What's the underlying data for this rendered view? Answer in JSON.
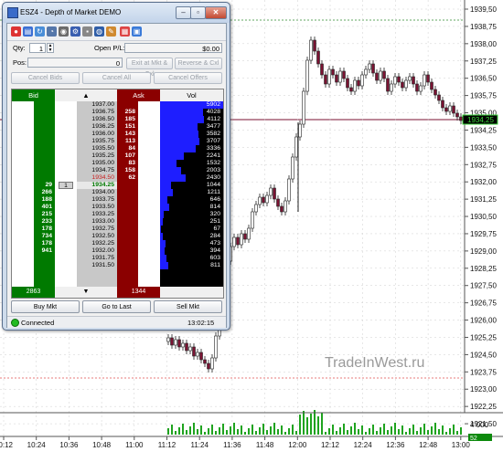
{
  "chart_data": {
    "type": "candlestick",
    "y_ticks": [
      "1939,50",
      "1938,75",
      "1938,00",
      "1937,25",
      "1936,50",
      "1935,75",
      "1935,00",
      "1934,25",
      "1933,50",
      "1932,75",
      "1932,00",
      "1931,25",
      "1930,50",
      "1929,75",
      "1929,00",
      "1928,25",
      "1927,50",
      "1926,75",
      "1926,00",
      "1925,25",
      "1924,50",
      "1923,75",
      "1923,00",
      "1922,25",
      "1921,50"
    ],
    "x_ticks": [
      "10:12",
      "10:24",
      "10:36",
      "10:48",
      "11:00",
      "11:12",
      "11:24",
      "11:36",
      "11:48",
      "12:00",
      "12:12",
      "12:24",
      "12:36",
      "12:48",
      "13:00"
    ],
    "last_price": "1934,25",
    "volume_tick": "4 000",
    "volume_badge": "52",
    "watermark": "TradeInWest.ru",
    "colors": {
      "up": "#ffffff",
      "down": "#7a1232",
      "outline": "#222222",
      "last_line": "#7a1232",
      "grid": "#cfcfcf",
      "hline": "#2e8b2e",
      "lowline": "#e05050"
    }
  },
  "window": {
    "title": "ESZ4 - Depth of Market DEMO",
    "minimize": "–",
    "restore": "▫",
    "close": "✕"
  },
  "toolbar_icons": [
    "pin-icon",
    "instrument-icon",
    "refresh-icon",
    "chart-icon",
    "alert-icon",
    "link-icon",
    "lock-icon",
    "settings-icon",
    "color-icon",
    "layout-icon",
    "properties-icon"
  ],
  "form": {
    "qty_label": "Qty:",
    "qty_value": "1",
    "pnl_label": "Open P/L:",
    "pnl_value": "$0.00",
    "pos_label": "Pos:",
    "pos_value": "0",
    "exit_button": "Exit at Mkt & Cxl",
    "reverse_button": "Reverse & Cxl",
    "cancel_bids": "Cancel Bids",
    "cancel_all": "Cancel All",
    "cancel_offers": "Cancel Offers"
  },
  "dom": {
    "headers": {
      "bid": "Bid",
      "price_arrow": "▲",
      "ask": "Ask",
      "vol": "Vol"
    },
    "rows": [
      {
        "price": "1937.00",
        "ask": "",
        "bid": "",
        "vol": "5902",
        "dir": "ask"
      },
      {
        "price": "1936.75",
        "ask": "258",
        "bid": "",
        "vol": "4028",
        "dir": "ask"
      },
      {
        "price": "1936.50",
        "ask": "185",
        "bid": "",
        "vol": "4112",
        "dir": "ask"
      },
      {
        "price": "1936.25",
        "ask": "151",
        "bid": "",
        "vol": "3477",
        "dir": "ask"
      },
      {
        "price": "1936.00",
        "ask": "143",
        "bid": "",
        "vol": "3582",
        "dir": "ask"
      },
      {
        "price": "1935.75",
        "ask": "113",
        "bid": "",
        "vol": "3707",
        "dir": "ask"
      },
      {
        "price": "1935.50",
        "ask": "84",
        "bid": "",
        "vol": "3336",
        "dir": "ask"
      },
      {
        "price": "1935.25",
        "ask": "107",
        "bid": "",
        "vol": "2241",
        "dir": "ask"
      },
      {
        "price": "1935.00",
        "ask": "83",
        "bid": "",
        "vol": "1532",
        "dir": "ask"
      },
      {
        "price": "1934.75",
        "ask": "158",
        "bid": "",
        "vol": "2003",
        "dir": "ask"
      },
      {
        "price": "1934.50",
        "ask": "62",
        "bid": "",
        "vol": "2430",
        "dir": "ask"
      },
      {
        "price": "1934.25",
        "ask": "",
        "bid": "29",
        "vol": "1044",
        "dir": "last"
      },
      {
        "price": "1934.00",
        "ask": "",
        "bid": "266",
        "vol": "1211",
        "dir": "bid"
      },
      {
        "price": "1933.75",
        "ask": "",
        "bid": "188",
        "vol": "646",
        "dir": "bid"
      },
      {
        "price": "1933.50",
        "ask": "",
        "bid": "401",
        "vol": "814",
        "dir": "bid"
      },
      {
        "price": "1933.25",
        "ask": "",
        "bid": "215",
        "vol": "320",
        "dir": "bid"
      },
      {
        "price": "1933.00",
        "ask": "",
        "bid": "233",
        "vol": "251",
        "dir": "bid"
      },
      {
        "price": "1932.75",
        "ask": "",
        "bid": "178",
        "vol": "67",
        "dir": "bid"
      },
      {
        "price": "1932.50",
        "ask": "",
        "bid": "734",
        "vol": "284",
        "dir": "bid"
      },
      {
        "price": "1932.25",
        "ask": "",
        "bid": "178",
        "vol": "473",
        "dir": "bid"
      },
      {
        "price": "1932.00",
        "ask": "",
        "bid": "941",
        "vol": "394",
        "dir": "bid"
      },
      {
        "price": "1931.75",
        "ask": "",
        "bid": "",
        "vol": "603",
        "dir": "bid"
      },
      {
        "price": "1931.50",
        "ask": "",
        "bid": "",
        "vol": "811",
        "dir": "bid"
      }
    ],
    "last_qty": "1",
    "vol_max": 5902,
    "footer": {
      "bid_total": "2863",
      "arrow": "▼",
      "ask_total": "1344"
    },
    "colors": {
      "bid": "#007a00",
      "ask": "#8b0000",
      "price_bg": "#c8c8c8",
      "vol": "#1e1eff",
      "last_price": "#007a00",
      "ask_price": "#c81e1e"
    }
  },
  "actions": {
    "buy": "Buy Mkt",
    "last": "Go to Last",
    "sell": "Sell Mkt"
  },
  "status": {
    "text": "Connected",
    "time": "13:02:15",
    "led": "#22bb22"
  }
}
